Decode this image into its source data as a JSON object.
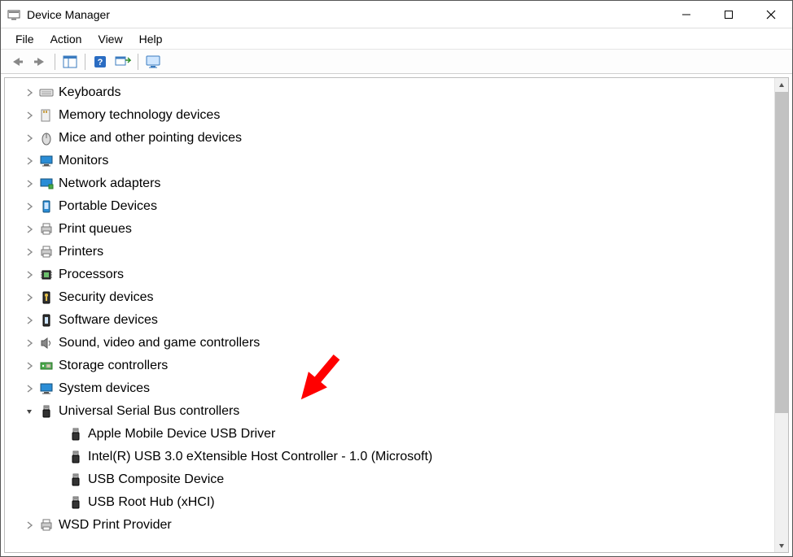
{
  "window": {
    "title": "Device Manager"
  },
  "menu": {
    "file": "File",
    "action": "Action",
    "view": "View",
    "help": "Help"
  },
  "toolbar_icons": {
    "back": "back-arrow-icon",
    "forward": "forward-arrow-icon",
    "properties": "properties-pane-icon",
    "help": "help-icon",
    "scan": "scan-hardware-icon",
    "view_monitor": "display-monitor-icon"
  },
  "tree": {
    "categories": [
      {
        "label": "Keyboards",
        "icon": "keyboard-icon",
        "expanded": false
      },
      {
        "label": "Memory technology devices",
        "icon": "memory-card-icon",
        "expanded": false
      },
      {
        "label": "Mice and other pointing devices",
        "icon": "mouse-icon",
        "expanded": false
      },
      {
        "label": "Monitors",
        "icon": "monitor-icon",
        "expanded": false
      },
      {
        "label": "Network adapters",
        "icon": "network-adapter-icon",
        "expanded": false
      },
      {
        "label": "Portable Devices",
        "icon": "portable-device-icon",
        "expanded": false
      },
      {
        "label": "Print queues",
        "icon": "printer-icon",
        "expanded": false
      },
      {
        "label": "Printers",
        "icon": "printer-icon",
        "expanded": false
      },
      {
        "label": "Processors",
        "icon": "cpu-icon",
        "expanded": false
      },
      {
        "label": "Security devices",
        "icon": "security-device-icon",
        "expanded": false
      },
      {
        "label": "Software devices",
        "icon": "software-device-icon",
        "expanded": false
      },
      {
        "label": "Sound, video and game controllers",
        "icon": "speaker-icon",
        "expanded": false
      },
      {
        "label": "Storage controllers",
        "icon": "storage-controller-icon",
        "expanded": false
      },
      {
        "label": "System devices",
        "icon": "system-device-icon",
        "expanded": false
      },
      {
        "label": "Universal Serial Bus controllers",
        "icon": "usb-icon",
        "expanded": true,
        "children": [
          {
            "label": "Apple Mobile Device USB Driver",
            "icon": "usb-device-icon"
          },
          {
            "label": "Intel(R) USB 3.0 eXtensible Host Controller - 1.0 (Microsoft)",
            "icon": "usb-device-icon"
          },
          {
            "label": "USB Composite Device",
            "icon": "usb-device-icon"
          },
          {
            "label": "USB Root Hub (xHCI)",
            "icon": "usb-device-icon"
          }
        ]
      },
      {
        "label": "WSD Print Provider",
        "icon": "printer-icon",
        "expanded": false
      }
    ]
  },
  "annotation": {
    "type": "arrow",
    "color": "#ff0000"
  }
}
